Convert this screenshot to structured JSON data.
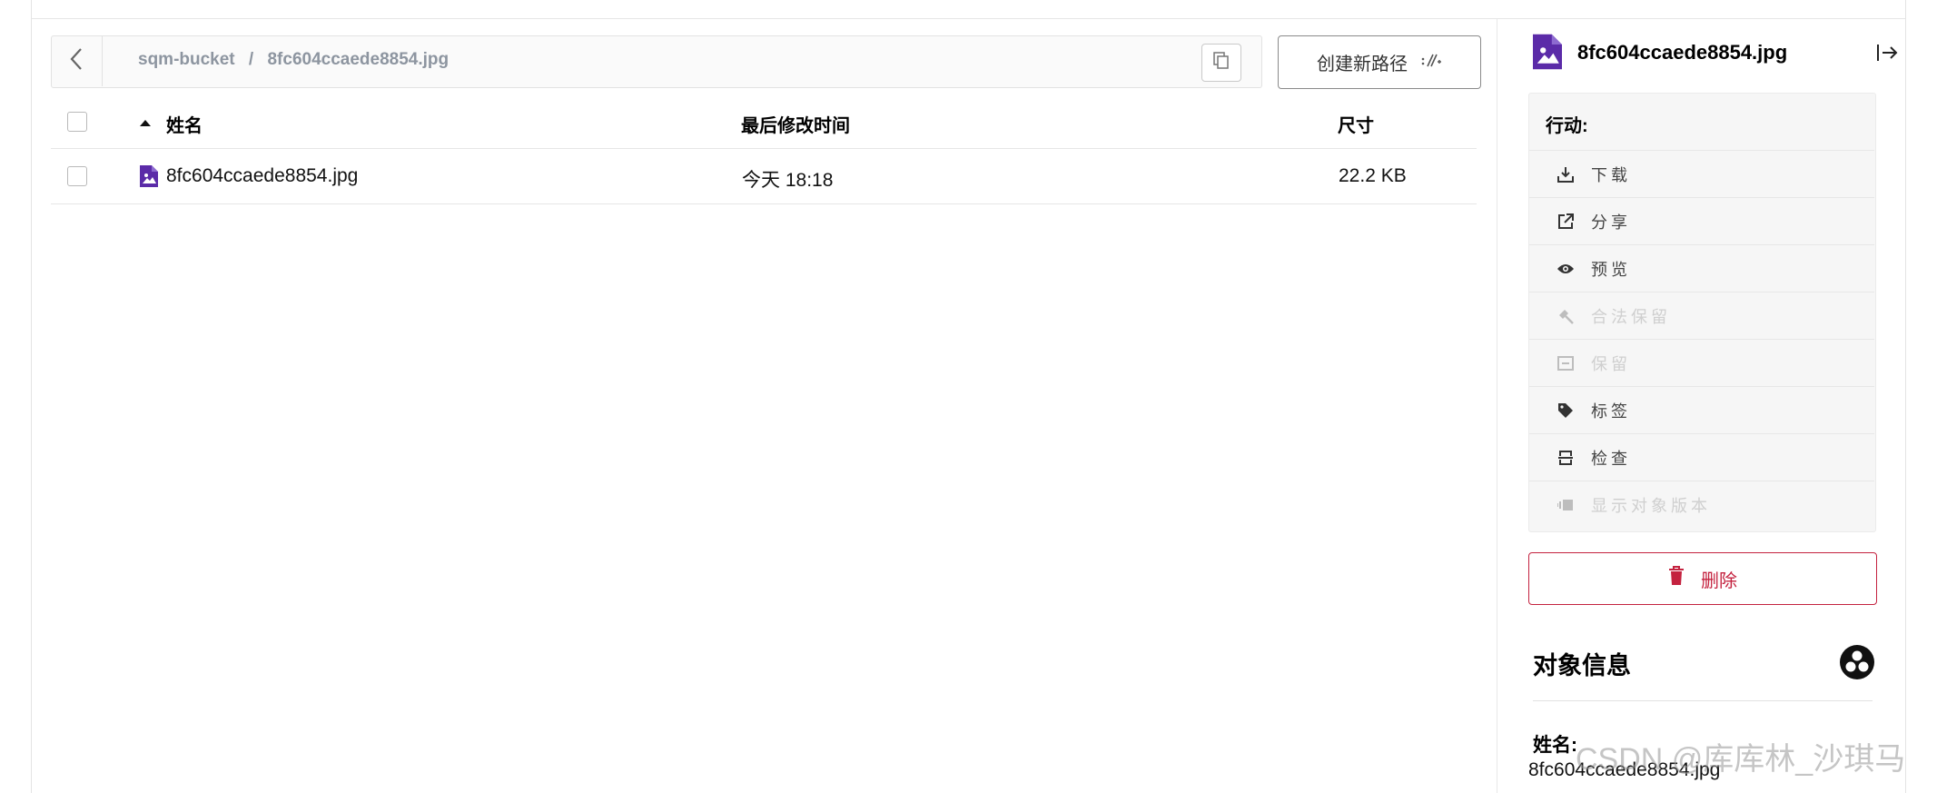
{
  "breadcrumb": {
    "bucket": "sqm-bucket",
    "separator": "/",
    "object": "8fc604ccaede8854.jpg"
  },
  "toolbar": {
    "new_path_label": "创建新路径"
  },
  "table": {
    "columns": [
      "姓名",
      "最后修改时间",
      "尺寸"
    ],
    "rows": [
      {
        "name": "8fc604ccaede8854.jpg",
        "modified": "今天 18:18",
        "size": "22.2 KB"
      }
    ]
  },
  "panel": {
    "title": "8fc604ccaede8854.jpg",
    "actions_heading": "行动:",
    "actions": [
      {
        "label": "下载",
        "icon": "download-icon",
        "enabled": true
      },
      {
        "label": "分享",
        "icon": "share-icon",
        "enabled": true
      },
      {
        "label": "预览",
        "icon": "eye-icon",
        "enabled": true
      },
      {
        "label": "合法保留",
        "icon": "gavel-icon",
        "enabled": false
      },
      {
        "label": "保留",
        "icon": "retention-icon",
        "enabled": false
      },
      {
        "label": "标签",
        "icon": "tag-icon",
        "enabled": true
      },
      {
        "label": "检查",
        "icon": "inspect-icon",
        "enabled": true
      },
      {
        "label": "显示对象版本",
        "icon": "versions-icon",
        "enabled": false
      }
    ],
    "delete_label": "删除",
    "info_title": "对象信息",
    "info_name_label": "姓名:",
    "info_name_value": "8fc604ccaede8854.jpg"
  },
  "watermark": "CSDN @库库林_沙琪马",
  "colors": {
    "file_icon": "#5b2ba8",
    "delete": "#c4223f",
    "breadcrumb_text": "#8d95a0"
  }
}
